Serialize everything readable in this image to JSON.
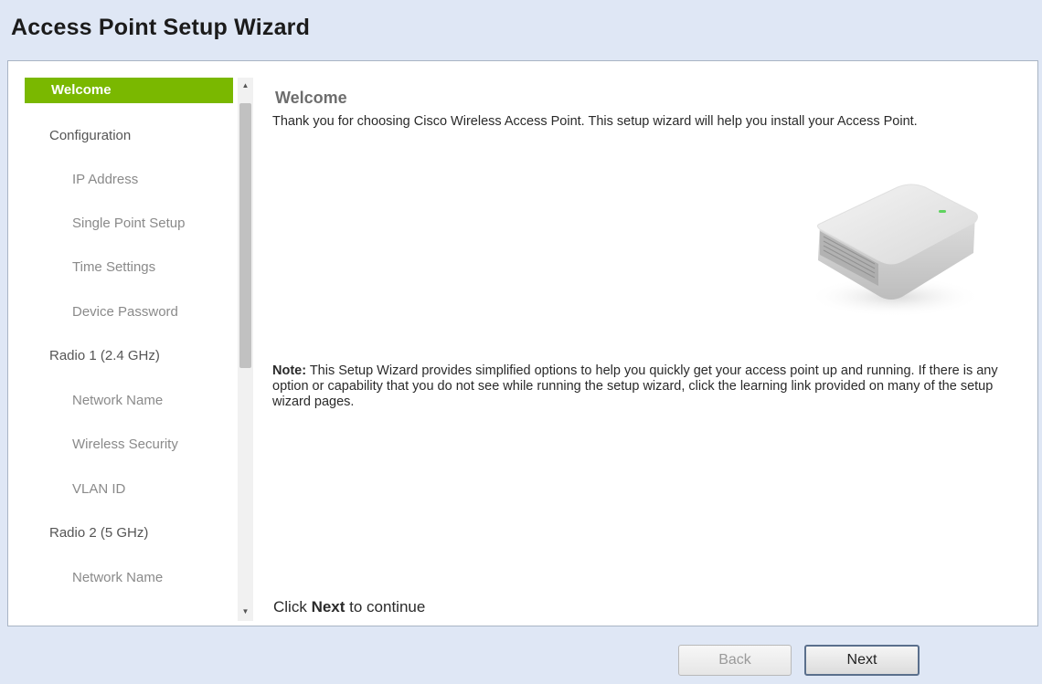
{
  "window": {
    "title": "Access Point Setup Wizard"
  },
  "sidebar": {
    "items": [
      {
        "label": "Welcome",
        "level": 1,
        "active": true
      },
      {
        "label": "Configuration",
        "level": 1
      },
      {
        "label": "IP Address",
        "level": 2
      },
      {
        "label": "Single Point Setup",
        "level": 2
      },
      {
        "label": "Time Settings",
        "level": 2
      },
      {
        "label": "Device Password",
        "level": 2
      },
      {
        "label": "Radio 1 (2.4 GHz)",
        "level": 1
      },
      {
        "label": "Network Name",
        "level": 2
      },
      {
        "label": "Wireless Security",
        "level": 2
      },
      {
        "label": "VLAN ID",
        "level": 2
      },
      {
        "label": "Radio 2 (5 GHz)",
        "level": 1
      },
      {
        "label": "Network Name",
        "level": 2
      }
    ]
  },
  "main": {
    "heading": "Welcome",
    "intro": "Thank you for choosing Cisco Wireless Access Point. This setup wizard will help you install your Access Point.",
    "note_label": "Note:",
    "note_text": " This Setup Wizard provides simplified options to help you quickly get your access point up and running. If there is any option or capability that you do not see while running the setup wizard, click the learning link provided on many of the setup wizard pages.",
    "continue_prefix": "Click ",
    "continue_bold": "Next",
    "continue_suffix": " to continue"
  },
  "footer": {
    "back_label": "Back",
    "next_label": "Next"
  },
  "colors": {
    "accent_active": "#7ab800",
    "background": "#dfe7f5"
  },
  "icons": {
    "scroll_up": "scroll-up-arrow-icon",
    "scroll_down": "scroll-down-arrow-icon",
    "device": "access-point-device-icon"
  }
}
